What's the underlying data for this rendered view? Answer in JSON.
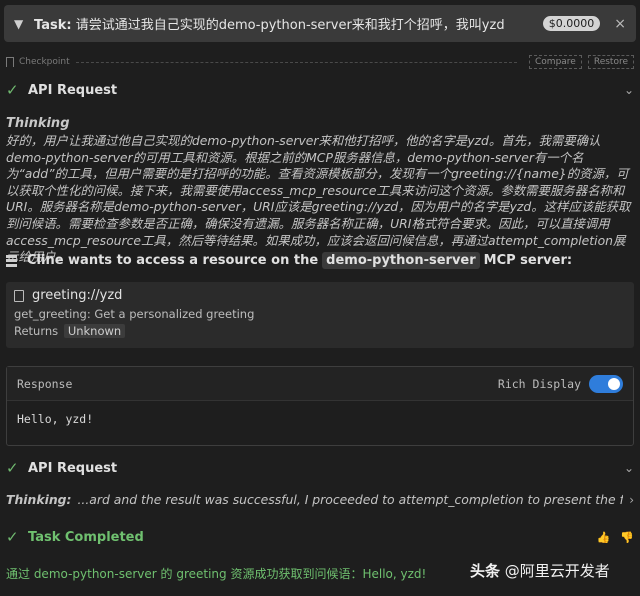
{
  "task": {
    "label": "Task:",
    "text": "请尝试通过我自己实现的demo-python-server来和我打个招呼，我叫yzd",
    "cost": "$0.0000",
    "close_glyph": "×"
  },
  "checkpoint": {
    "label": "Checkpoint",
    "compare_label": "Compare",
    "restore_label": "Restore"
  },
  "api_request_1": {
    "label": "API Request"
  },
  "thinking": {
    "label": "Thinking",
    "text": "好的，用户让我通过他自己实现的demo-python-server来和他打招呼，他的名字是yzd。首先，我需要确认demo-python-server的可用工具和资源。根据之前的MCP服务器信息，demo-python-server有一个名为“add”的工具，但用户需要的是打招呼的功能。查看资源模板部分，发现有一个greeting://{name}的资源，可以获取个性化的问候。接下来，我需要使用access_mcp_resource工具来访问这个资源。参数需要服务器名称和URI。服务器名称是demo-python-server，URI应该是greeting://yzd，因为用户的名字是yzd。这样应该能获取到问候语。需要检查参数是否正确，确保没有遗漏。服务器名称正确，URI格式符合要求。因此，可以直接调用access_mcp_resource工具，然后等待结果。如果成功，应该会返回问候信息，再通过attempt_completion展示给用户。"
  },
  "access": {
    "prefix": "Cline wants to access a resource on the",
    "server": "demo-python-server",
    "suffix": "MCP server:"
  },
  "resource": {
    "uri": "greeting://yzd",
    "description": "get_greeting: Get a personalized greeting",
    "returns_label": "Returns",
    "returns_value": "Unknown"
  },
  "response": {
    "label": "Response",
    "rich_display_label": "Rich Display",
    "rich_display_on": true,
    "body": "Hello, yzd!"
  },
  "api_request_2": {
    "label": "API Request"
  },
  "thinking_collapsed": {
    "label": "Thinking:",
    "text": "...ard and the result was successful, I proceeded to attempt_completion to present the final greeting."
  },
  "completed": {
    "label": "Task Completed"
  },
  "result": {
    "text": "通过 demo-python-server 的 greeting 资源成功获取到问候语：Hello, yzd!"
  },
  "watermark": {
    "brand": "头条",
    "handle": "@阿里云开发者"
  },
  "colors": {
    "success": "#6fc06f",
    "toggle_on": "#2f7ddb",
    "panel": "#2b2b2b",
    "background": "#1e1e1e"
  },
  "icons": [
    "chevron-down-icon",
    "close-icon",
    "bookmark-icon",
    "check-icon",
    "server-icon",
    "file-icon",
    "chevron-right-icon",
    "thumbs-up-icon",
    "thumbs-down-icon"
  ]
}
